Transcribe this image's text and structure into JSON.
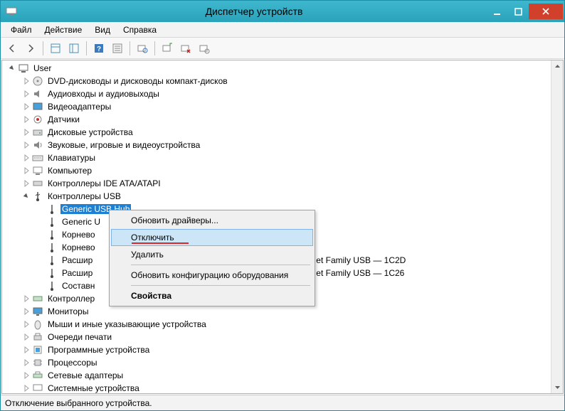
{
  "titlebar": {
    "title": "Диспетчер устройств"
  },
  "menubar": {
    "file": "Файл",
    "action": "Действие",
    "view": "Вид",
    "help": "Справка"
  },
  "tree": {
    "root": "User",
    "categories": {
      "dvd": "DVD-дисководы и дисководы компакт-дисков",
      "audio": "Аудиовходы и аудиовыходы",
      "video": "Видеоадаптеры",
      "sensors": "Датчики",
      "disk": "Дисковые устройства",
      "sound": "Звуковые, игровые и видеоустройства",
      "keyboard": "Клавиатуры",
      "computer": "Компьютер",
      "ide": "Контроллеры IDE ATA/ATAPI",
      "usb": "Контроллеры USB",
      "storage_ctrl": "Контроллер",
      "monitors": "Мониторы",
      "mice": "Мыши и иные указывающие устройства",
      "printq": "Очереди печати",
      "software": "Программные устройства",
      "cpu": "Процессоры",
      "network": "Сетевые адаптеры",
      "system": "Системные устройства"
    },
    "usb_children": {
      "generic1": "Generic USB Hub",
      "generic2": "Generic U",
      "root1": "Корнево",
      "root2": "Корнево",
      "ext1_suffix": "et Family USB — 1C2D",
      "ext1_prefix": "Расшир",
      "ext2_prefix": "Расшир",
      "ext2_suffix": "et Family USB — 1C26",
      "composite": "Составн"
    }
  },
  "context_menu": {
    "update": "Обновить драйверы...",
    "disable": "Отключить",
    "delete": "Удалить",
    "scan": "Обновить конфигурацию оборудования",
    "props": "Свойства"
  },
  "statusbar": {
    "text": "Отключение выбранного устройства."
  }
}
